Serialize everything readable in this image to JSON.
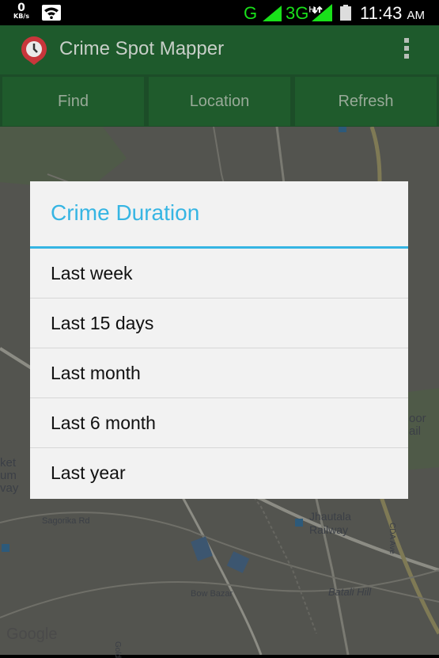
{
  "status_bar": {
    "speed_value": "0",
    "speed_unit": "KB/s",
    "network1": "G",
    "network2": "3G",
    "network2_sup": "H",
    "time": "11:43",
    "ampm": "AM"
  },
  "action_bar": {
    "title": "Crime Spot Mapper",
    "brand_color": "#1e5a2c"
  },
  "buttons": [
    {
      "label": "Find"
    },
    {
      "label": "Location"
    },
    {
      "label": "Refresh"
    }
  ],
  "map": {
    "labels": {
      "sagorika": "Sagorika Rd",
      "jhautala": "Jhautala",
      "railway": "Railway",
      "bow_bazar": "Bow Bazar",
      "batali_hill": "Batali Hill",
      "cda_ave": "CDA Ave",
      "google": "Google",
      "ket": "ket",
      "um": "um",
      "vay": "vay",
      "oor": "oor",
      "ail": "ail",
      "gold": "Gold"
    }
  },
  "dialog": {
    "title": "Crime Duration",
    "accent_color": "#36b5e3",
    "options": [
      {
        "label": "Last week"
      },
      {
        "label": "Last 15 days"
      },
      {
        "label": "Last month"
      },
      {
        "label": "Last 6 month"
      },
      {
        "label": "Last year"
      }
    ]
  }
}
